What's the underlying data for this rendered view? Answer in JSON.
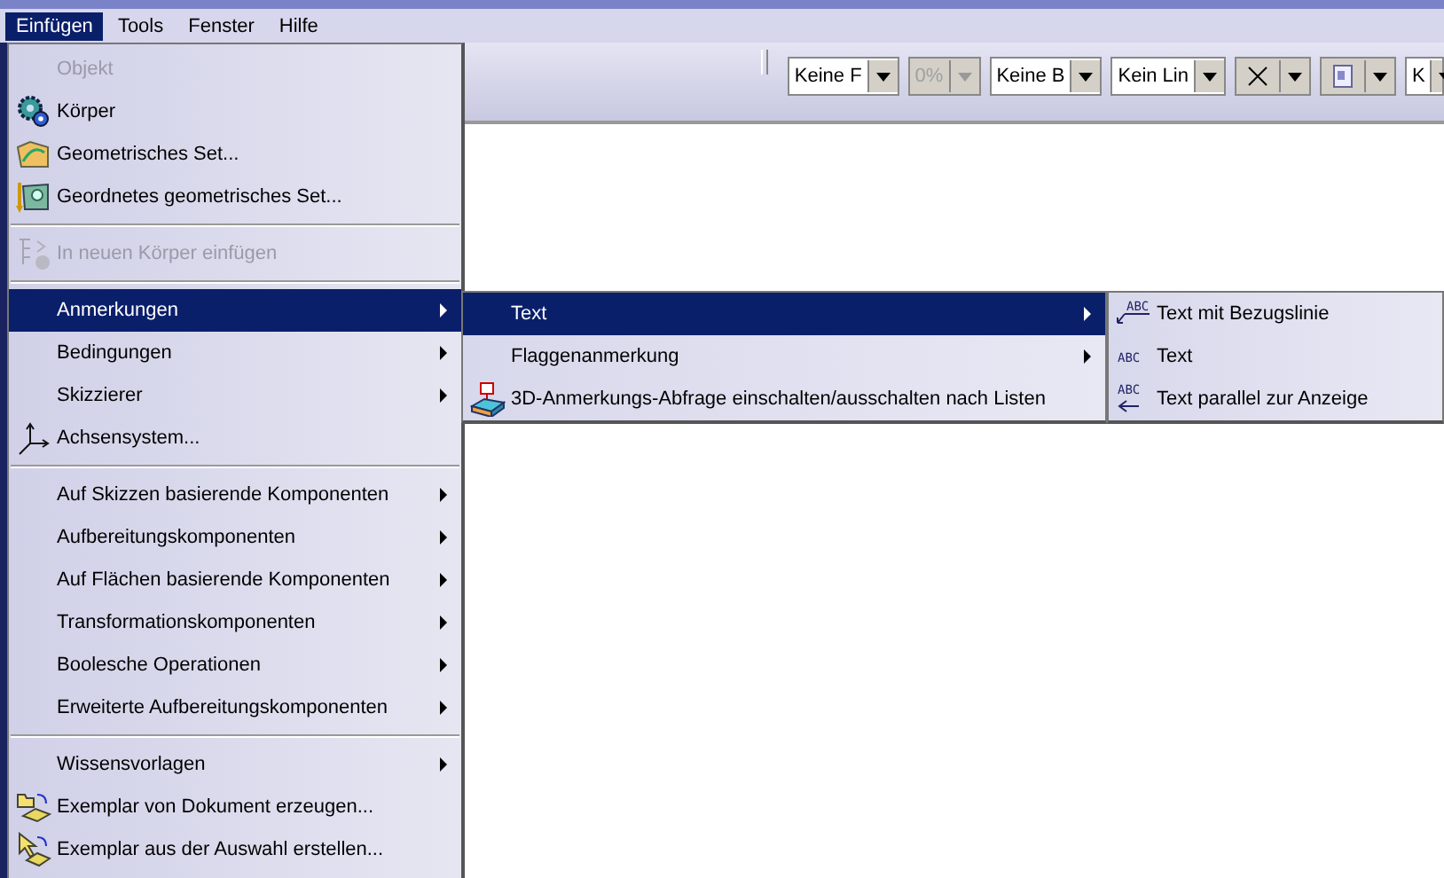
{
  "menubar": [
    {
      "label": "Einfügen",
      "selected": true
    },
    {
      "label": "Tools",
      "selected": false
    },
    {
      "label": "Fenster",
      "selected": false
    },
    {
      "label": "Hilfe",
      "selected": false
    }
  ],
  "toolbar": {
    "combos": [
      {
        "kind": "text",
        "value": "Keine F",
        "disabled": false
      },
      {
        "kind": "text",
        "value": "0%",
        "disabled": true
      },
      {
        "kind": "text",
        "value": "Keine B",
        "disabled": false
      },
      {
        "kind": "text",
        "value": "Kein Lin",
        "disabled": false
      },
      {
        "kind": "cross",
        "disabled": false
      },
      {
        "kind": "page",
        "disabled": false
      },
      {
        "kind": "text",
        "value": "K",
        "disabled": false
      }
    ]
  },
  "menu": {
    "sections": [
      {
        "items": [
          {
            "label": "Objekt",
            "disabled": true,
            "selected": false,
            "submenu": false
          },
          {
            "label": "Körper",
            "disabled": false,
            "selected": false,
            "submenu": false
          },
          {
            "label": "Geometrisches Set...",
            "disabled": false,
            "selected": false,
            "submenu": false
          },
          {
            "label": "Geordnetes geometrisches Set...",
            "disabled": false,
            "selected": false,
            "submenu": false
          }
        ]
      },
      {
        "items": [
          {
            "label": "In neuen Körper einfügen",
            "disabled": true,
            "selected": false,
            "submenu": false
          }
        ]
      },
      {
        "items": [
          {
            "label": "Anmerkungen",
            "disabled": false,
            "selected": true,
            "submenu": true
          },
          {
            "label": "Bedingungen",
            "disabled": false,
            "selected": false,
            "submenu": true
          },
          {
            "label": "Skizzierer",
            "disabled": false,
            "selected": false,
            "submenu": true
          },
          {
            "label": "Achsensystem...",
            "disabled": false,
            "selected": false,
            "submenu": false
          }
        ]
      },
      {
        "items": [
          {
            "label": "Auf Skizzen basierende Komponenten",
            "disabled": false,
            "selected": false,
            "submenu": true
          },
          {
            "label": "Aufbereitungskomponenten",
            "disabled": false,
            "selected": false,
            "submenu": true
          },
          {
            "label": "Auf Flächen basierende Komponenten",
            "disabled": false,
            "selected": false,
            "submenu": true
          },
          {
            "label": "Transformationskomponenten",
            "disabled": false,
            "selected": false,
            "submenu": true
          },
          {
            "label": "Boolesche Operationen",
            "disabled": false,
            "selected": false,
            "submenu": true
          },
          {
            "label": "Erweiterte Aufbereitungskomponenten",
            "disabled": false,
            "selected": false,
            "submenu": true
          }
        ]
      },
      {
        "items": [
          {
            "label": "Wissensvorlagen",
            "disabled": false,
            "selected": false,
            "submenu": true
          },
          {
            "label": "Exemplar von Dokument erzeugen...",
            "disabled": false,
            "selected": false,
            "submenu": false
          },
          {
            "label": "Exemplar aus der Auswahl erstellen...",
            "disabled": false,
            "selected": false,
            "submenu": false
          }
        ]
      }
    ]
  },
  "submenu": {
    "items": [
      {
        "label": "Text",
        "disabled": false,
        "selected": true,
        "submenu": true
      },
      {
        "label": "Flaggenanmerkung",
        "disabled": false,
        "selected": false,
        "submenu": true
      },
      {
        "label": "3D-Anmerkungs-Abfrage einschalten/ausschalten nach Listen",
        "disabled": false,
        "selected": false,
        "submenu": false
      }
    ]
  },
  "submenu2": {
    "items": [
      {
        "label": "Text mit Bezugslinie",
        "icon_text": "ABC",
        "disabled": false,
        "selected": false,
        "submenu": false
      },
      {
        "label": "Text",
        "icon_text": "ABC",
        "disabled": false,
        "selected": false,
        "submenu": false
      },
      {
        "label": "Text parallel zur Anzeige",
        "icon_text": "ABC",
        "disabled": false,
        "selected": false,
        "submenu": false
      }
    ]
  }
}
